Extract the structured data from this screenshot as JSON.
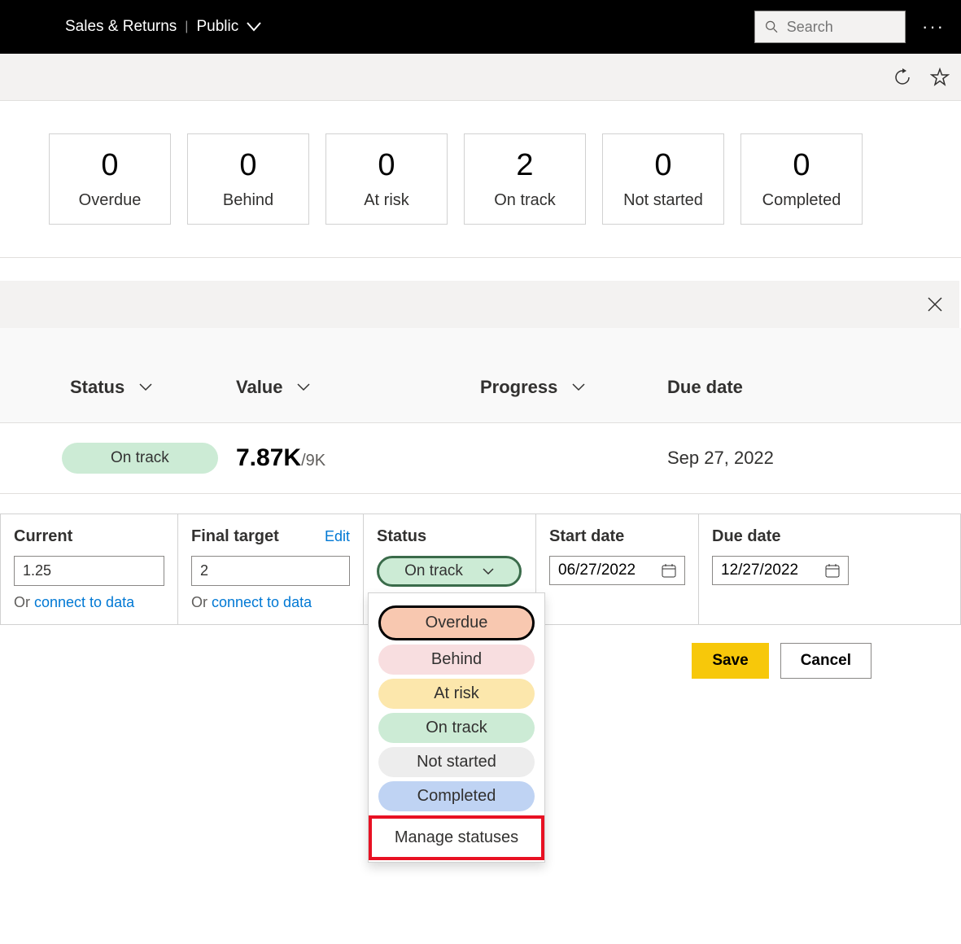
{
  "topbar": {
    "workspace": "Sales & Returns",
    "visibility": "Public",
    "search_placeholder": "Search"
  },
  "status_cards": [
    {
      "count": "0",
      "label": "Overdue"
    },
    {
      "count": "0",
      "label": "Behind"
    },
    {
      "count": "0",
      "label": "At risk"
    },
    {
      "count": "2",
      "label": "On track"
    },
    {
      "count": "0",
      "label": "Not started"
    },
    {
      "count": "0",
      "label": "Completed"
    }
  ],
  "headers": {
    "status": "Status",
    "value": "Value",
    "progress": "Progress",
    "due": "Due date"
  },
  "row": {
    "status": "On track",
    "value": "7.87K",
    "value_target": "/9K",
    "due_date": "Sep 27, 2022"
  },
  "edit": {
    "current_label": "Current",
    "current_value": "1.25",
    "final_label": "Final target",
    "final_value": "2",
    "edit_link": "Edit",
    "or_text": "Or ",
    "connect_link": "connect to data",
    "status_label": "Status",
    "status_value": "On track",
    "start_label": "Start date",
    "start_value": "06/27/2022",
    "due_label": "Due date",
    "due_value": "12/27/2022"
  },
  "status_menu": {
    "overdue": "Overdue",
    "behind": "Behind",
    "atrisk": "At risk",
    "ontrack": "On track",
    "notstarted": "Not started",
    "completed": "Completed",
    "manage": "Manage statuses"
  },
  "buttons": {
    "save": "Save",
    "cancel": "Cancel"
  }
}
